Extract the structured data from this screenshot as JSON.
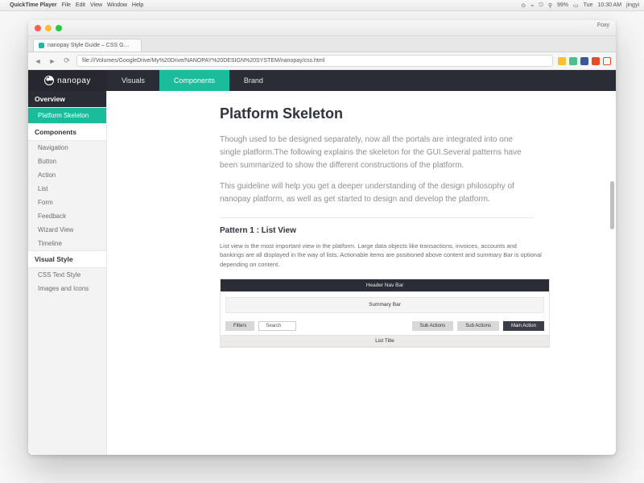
{
  "mac_menubar": {
    "app": "QuickTime Player",
    "menus": [
      "File",
      "Edit",
      "View",
      "Window",
      "Help"
    ],
    "battery": "99%",
    "day": "Tue",
    "time": "10:30 AM",
    "user": "jingyi"
  },
  "window": {
    "title": "Foxy"
  },
  "browser": {
    "tab_title": "nanopay Style Guide – CSS G…",
    "url": "file:///Volumes/GoogleDrive/My%20Drive/NANOPAY%20DESIGN%20SYSTEM/nanopay/css.html"
  },
  "app": {
    "brand": "nanopay",
    "topnav": [
      {
        "label": "Visuals",
        "active": false
      },
      {
        "label": "Components",
        "active": true
      },
      {
        "label": "Brand",
        "active": false
      }
    ],
    "sidebar": {
      "groups": [
        {
          "heading": "Overview",
          "dark": true,
          "items": [
            {
              "label": "Platform Skeleton",
              "active": true
            }
          ]
        },
        {
          "heading": "Components",
          "items": [
            {
              "label": "Navigation"
            },
            {
              "label": "Button"
            },
            {
              "label": "Action"
            },
            {
              "label": "List"
            },
            {
              "label": "Form"
            },
            {
              "label": "Feedback"
            },
            {
              "label": "Wizard View"
            },
            {
              "label": "Timeline"
            }
          ]
        },
        {
          "heading": "Visual Style",
          "items": [
            {
              "label": "CSS Text Style"
            },
            {
              "label": "Images and Icons"
            }
          ]
        }
      ]
    }
  },
  "content": {
    "title": "Platform Skeleton",
    "p1": "Though used to be designed separately, now all the portals are integrated into one single platform.The following explains the skeleton for the GUI.Several patterns have been summarized to show the different constructions of the platform.",
    "p2": "This guideline will help you get a deeper understanding of the design philosophy of nanopay platform, as well as get started to design and develop the platform.",
    "pattern1_heading": "Pattern 1 : List View",
    "pattern1_body": "List view is the most important view in the platform. Large data objects like transactions, invoices, accounts and bankings are all displayed in the way of lists. Actionable items are positioned above content and summary Bar is optional depending on content.",
    "wire": {
      "header": "Header Nav Bar",
      "summary": "Summary Bar",
      "filters": "Filters",
      "search": "Search",
      "sub_actions_a": "Sub Actions",
      "sub_actions_b": "Sub Actions",
      "main_action": "Main Action",
      "list_title": "List Title"
    }
  },
  "colors": {
    "accent": "#1bbc9b",
    "dark": "#2b2d36"
  }
}
